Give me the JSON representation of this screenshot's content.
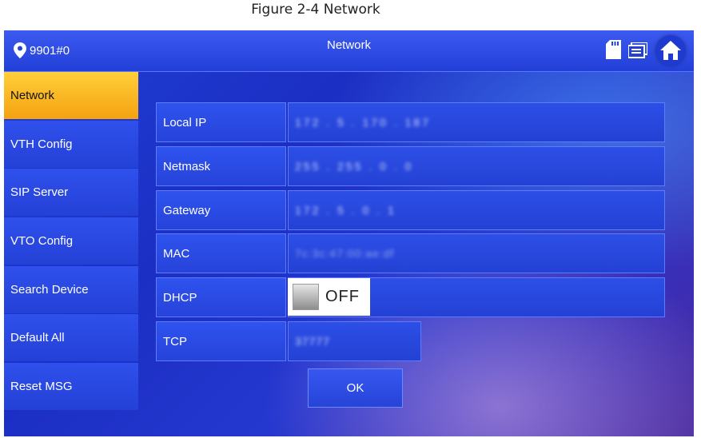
{
  "caption": "Figure 2-4 Network",
  "header": {
    "location": "9901#0",
    "title": "Network",
    "icons": [
      "location-pin-icon",
      "sd-card-icon",
      "message-icon",
      "home-icon"
    ]
  },
  "sidebar": {
    "items": [
      {
        "label": "Network",
        "active": true
      },
      {
        "label": "VTH Config",
        "active": false
      },
      {
        "label": "SIP Server",
        "active": false
      },
      {
        "label": "VTO Config",
        "active": false
      },
      {
        "label": "Search Device",
        "active": false
      },
      {
        "label": "Default All",
        "active": false
      },
      {
        "label": "Reset MSG",
        "active": false
      }
    ]
  },
  "form": {
    "local_ip": {
      "label": "Local IP",
      "value": "172 . 5 . 170 . 187"
    },
    "netmask": {
      "label": "Netmask",
      "value": "255 . 255 . 0 . 0"
    },
    "gateway": {
      "label": "Gateway",
      "value": "172 . 5 . 0 . 1"
    },
    "mac": {
      "label": "MAC",
      "value": "7c:3c:47:00:ae:df"
    },
    "dhcp": {
      "label": "DHCP",
      "state": "OFF"
    },
    "tcp": {
      "label": "TCP",
      "value": "37777"
    }
  },
  "ok_label": "OK",
  "colors": {
    "accent_active": "#f5a20f",
    "panel_blue": "#2643da",
    "border_blue": "#5d7dff"
  }
}
